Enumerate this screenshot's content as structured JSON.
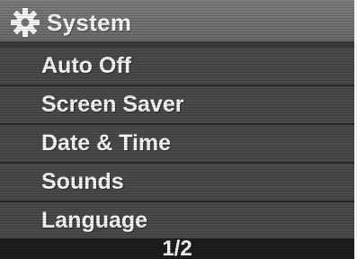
{
  "header": {
    "title": "System",
    "icon": "gear-icon"
  },
  "menu": {
    "items": [
      {
        "label": "Auto Off"
      },
      {
        "label": "Screen Saver"
      },
      {
        "label": "Date & Time"
      },
      {
        "label": "Sounds"
      },
      {
        "label": "Language"
      }
    ]
  },
  "footer": {
    "page_indicator": "1/2"
  }
}
